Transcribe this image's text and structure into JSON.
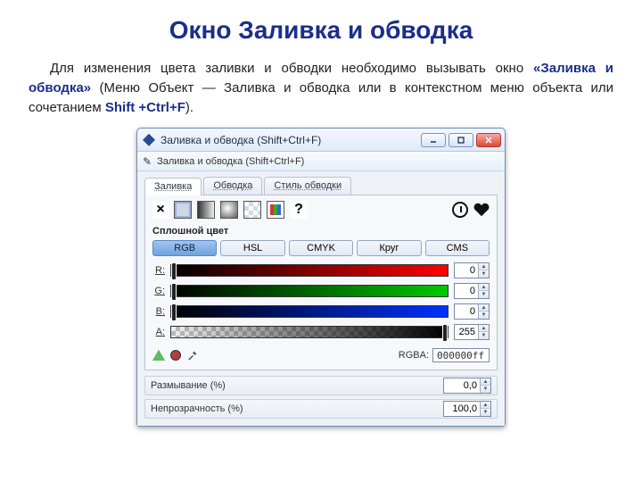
{
  "title": "Окно Заливка и обводка",
  "para": {
    "p1": "Для изменения цвета заливки и обводки необходимо вызывать окно ",
    "p2": "«Заливка и обводка»",
    "p3": " (Меню Объект — Заливка и обводка или в контекстном меню объекта или сочетанием ",
    "p4": "Shift +Ctrl+F",
    "p5": ")."
  },
  "win": {
    "title": "Заливка и обводка (Shift+Ctrl+F)",
    "toolbar": "Заливка и обводка (Shift+Ctrl+F)",
    "tabs": [
      "Заливка",
      "Обводка",
      "Стиль обводки"
    ],
    "subheading": "Сплошной цвет",
    "modes": [
      "RGB",
      "HSL",
      "CMYK",
      "Круг",
      "CMS"
    ],
    "channels": [
      {
        "label": "R",
        "value": 0,
        "class": "red",
        "thumb": 0
      },
      {
        "label": "G",
        "value": 0,
        "class": "green",
        "thumb": 0
      },
      {
        "label": "B",
        "value": 0,
        "class": "blue",
        "thumb": 0
      },
      {
        "label": "A",
        "value": 255,
        "class": "alpha",
        "thumb": 100
      }
    ],
    "rgba_label": "RGBA:",
    "rgba_value": "000000ff",
    "blur_label": "Размывание (%)",
    "blur_value": "0,0",
    "opacity_label": "Непрозрачность (%)",
    "opacity_value": "100,0"
  }
}
